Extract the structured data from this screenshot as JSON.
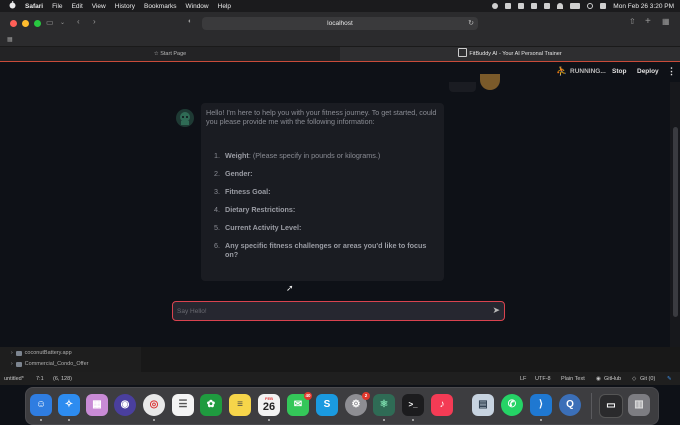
{
  "menubar": {
    "app": "Safari",
    "items": [
      "File",
      "Edit",
      "View",
      "History",
      "Bookmarks",
      "Window",
      "Help"
    ],
    "datetime": "Mon Feb 26  3:20 PM"
  },
  "browser": {
    "url": "localhost",
    "tabs": [
      {
        "label": "Start Page"
      },
      {
        "label": "FitBuddy AI - Your AI Personal Trainer"
      }
    ]
  },
  "app_header": {
    "status": "RUNNING...",
    "stop": "Stop",
    "deploy": "Deploy"
  },
  "chat": {
    "intro": "Hello! I'm here to help you with your fitness journey. To get started, could you please provide me with the following information:",
    "items": [
      {
        "num": "1.",
        "label": "Weight",
        "rest": ": (Please specify in pounds or kilograms.)"
      },
      {
        "num": "2.",
        "label": "Gender:",
        "rest": ""
      },
      {
        "num": "3.",
        "label": "Fitness Goal:",
        "rest": ""
      },
      {
        "num": "4.",
        "label": "Dietary Restrictions:",
        "rest": ""
      },
      {
        "num": "5.",
        "label": "Current Activity Level:",
        "rest": ""
      },
      {
        "num": "6.",
        "label": "Any specific fitness challenges or areas you'd like to focus on?",
        "rest": ""
      }
    ],
    "input_placeholder": "Say Hello!"
  },
  "files": [
    {
      "name": "coconutBattery.app"
    },
    {
      "name": "Commercial_Condo_Offer"
    }
  ],
  "statusbar": {
    "file": "untitled*",
    "position": "7:1",
    "selection": "(6, 128)",
    "line_ending": "LF",
    "encoding": "UTF-8",
    "mode": "Plain Text",
    "github": "GitHub",
    "git": "Git (0)"
  },
  "dock": {
    "calendar_month": "FEB",
    "calendar_day": "26",
    "messages_badge": "40",
    "settings_badge": "2"
  },
  "colors": {
    "accent": "#d9434f",
    "background": "#0e1117",
    "message_bg": "#1a1c22"
  }
}
